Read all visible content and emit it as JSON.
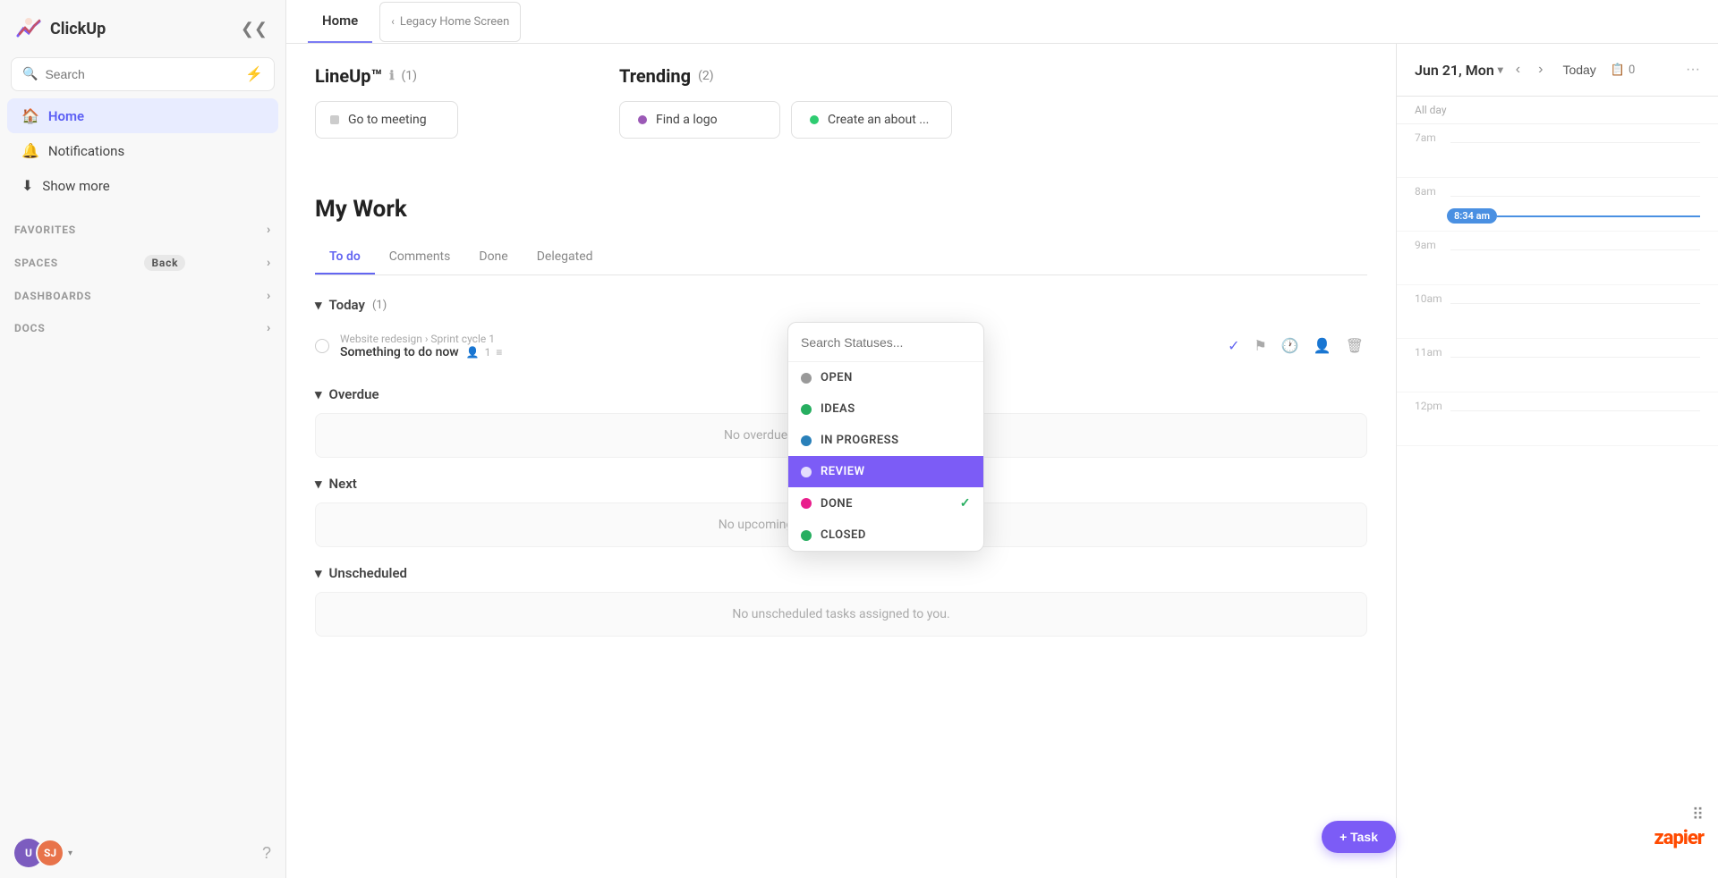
{
  "app": {
    "name": "ClickUp",
    "logo_text": "ClickUp"
  },
  "sidebar": {
    "search_placeholder": "Search",
    "nav_items": [
      {
        "id": "home",
        "label": "Home",
        "icon": "🏠",
        "active": true
      },
      {
        "id": "notifications",
        "label": "Notifications",
        "icon": "🔔"
      },
      {
        "id": "show-more",
        "label": "Show more",
        "icon": "↓"
      }
    ],
    "sections": [
      {
        "id": "favorites",
        "label": "FAVORITES",
        "chevron": "›"
      },
      {
        "id": "spaces",
        "label": "SPACES",
        "chevron": "›",
        "back_label": "Back"
      },
      {
        "id": "dashboards",
        "label": "DASHBOARDS",
        "chevron": "›"
      },
      {
        "id": "docs",
        "label": "DOCS",
        "chevron": "›"
      }
    ],
    "avatar_u": "U",
    "avatar_sj": "SJ"
  },
  "tabs": {
    "active": "Home",
    "items": [
      "Home"
    ],
    "breadcrumb": "Legacy Home Screen"
  },
  "lineup": {
    "title": "LineUp™",
    "info": "ℹ",
    "count": "(1)",
    "cards": [
      {
        "label": "Go to meeting",
        "dot_color": "#ccc"
      }
    ]
  },
  "trending": {
    "title": "Trending",
    "count": "(2)",
    "cards": [
      {
        "label": "Find a logo",
        "dot_color": "#9b59b6"
      },
      {
        "label": "Create an about ...",
        "dot_color": "#2ecc71"
      }
    ]
  },
  "my_work": {
    "title": "My Work",
    "tabs": [
      "To do",
      "Comments",
      "Done",
      "Delegated"
    ],
    "active_tab": "To do"
  },
  "today": {
    "label": "Today",
    "count": "(1)",
    "task": {
      "breadcrumb": "Website redesign › Sprint cycle 1",
      "title": "Something to do now",
      "subtask_count": "1",
      "description_icon": "≡"
    }
  },
  "overdue": {
    "label": "Overdue",
    "empty": "No overdue tasks or reminders scheduled."
  },
  "next_section": {
    "label": "Next",
    "empty": "No upcoming tasks or reminders scheduled."
  },
  "unscheduled": {
    "label": "Unscheduled",
    "empty": "No unscheduled tasks assigned to you."
  },
  "status_dropdown": {
    "search_placeholder": "Search Statuses...",
    "statuses": [
      {
        "id": "open",
        "label": "OPEN",
        "dot_class": "dot-gray"
      },
      {
        "id": "ideas",
        "label": "IDEAS",
        "dot_class": "dot-green"
      },
      {
        "id": "in_progress",
        "label": "IN PROGRESS",
        "dot_class": "dot-blue"
      },
      {
        "id": "review",
        "label": "REVIEW",
        "dot_class": "dot-purple",
        "active": true
      },
      {
        "id": "done",
        "label": "DONE",
        "dot_class": "dot-pink",
        "check": true
      },
      {
        "id": "closed",
        "label": "CLOSED",
        "dot_class": "dot-green2"
      }
    ]
  },
  "calendar": {
    "date_title": "Jun 21, Mon",
    "today_label": "Today",
    "task_count": "0",
    "time_slots": [
      {
        "label": "7am"
      },
      {
        "label": "8am",
        "current_time": "8:34 am"
      },
      {
        "label": "9am"
      },
      {
        "label": "10am"
      },
      {
        "label": "11am"
      },
      {
        "label": "12pm"
      }
    ]
  },
  "add_task": {
    "label": "+ Task"
  },
  "zapier": {
    "label": "zapier"
  }
}
